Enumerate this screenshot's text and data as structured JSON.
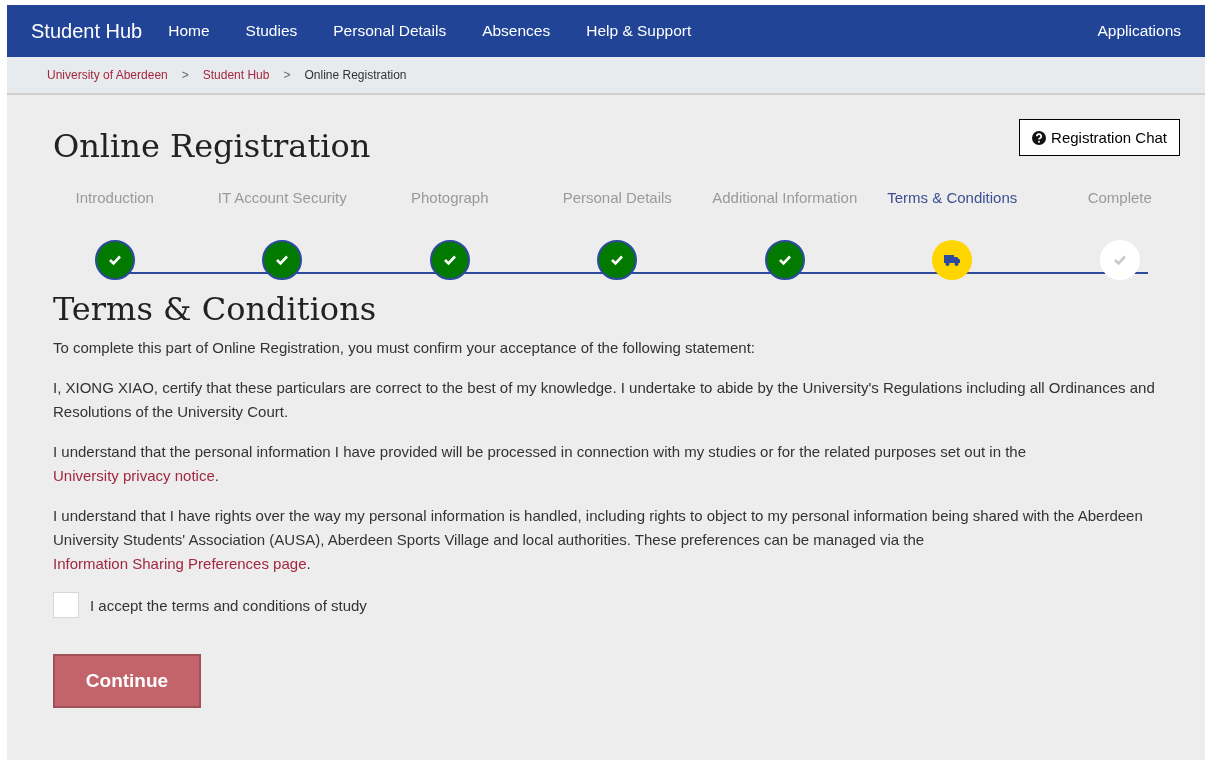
{
  "nav": {
    "brand": "Student Hub",
    "items": [
      {
        "label": "Home"
      },
      {
        "label": "Studies"
      },
      {
        "label": "Personal Details"
      },
      {
        "label": "Absences"
      },
      {
        "label": "Help & Support"
      }
    ],
    "right": "Applications"
  },
  "breadcrumb": [
    {
      "label": "University of Aberdeen",
      "kind": "link"
    },
    {
      "label": ">",
      "kind": "sep"
    },
    {
      "label": "Student Hub",
      "kind": "link"
    },
    {
      "label": ">",
      "kind": "sep"
    },
    {
      "label": "Online Registration",
      "kind": "current"
    }
  ],
  "page_title": "Online Registration",
  "chat_button": "Registration Chat",
  "steps": [
    {
      "label": "Introduction",
      "completed": true,
      "selected": false
    },
    {
      "label": "IT Account Security",
      "completed": true,
      "selected": false
    },
    {
      "label": "Photograph",
      "completed": true,
      "selected": false
    },
    {
      "label": "Personal Details",
      "completed": true,
      "selected": false
    },
    {
      "label": "Additional Information",
      "completed": true,
      "selected": false
    },
    {
      "label": "Terms & Conditions",
      "completed": false,
      "selected": true
    },
    {
      "label": "Complete",
      "completed": false,
      "selected": false
    }
  ],
  "section_title": "Terms & Conditions",
  "paragraphs": [
    {
      "parts": [
        {
          "kind": "text",
          "text": "To complete this part of Online Registration, you must confirm your acceptance of the following statement:"
        }
      ]
    },
    {
      "parts": [
        {
          "kind": "text",
          "text": "I, XIONG XIAO, certify that these particulars are correct to the best of my knowledge. I undertake to abide by the University's Regulations including all Ordinances and Resolutions of the University Court."
        }
      ]
    },
    {
      "parts": [
        {
          "kind": "text",
          "text": "I understand that the personal information I have provided will be processed in connection with my studies or for the related purposes set out in the "
        },
        {
          "kind": "link",
          "text": "University privacy notice"
        },
        {
          "kind": "text",
          "text": "."
        }
      ]
    },
    {
      "parts": [
        {
          "kind": "text",
          "text": "I understand that I have rights over the way my personal information is handled, including rights to object to my personal information being shared with the Aberdeen University Students' Association (AUSA), Aberdeen Sports Village and local authorities. These preferences can be managed via the "
        },
        {
          "kind": "link",
          "text": "Information Sharing Preferences page"
        },
        {
          "kind": "text",
          "text": "."
        }
      ]
    }
  ],
  "accept": {
    "label": "I accept the terms and conditions of study",
    "checked": false
  },
  "continue_button": {
    "label": "Continue",
    "disabled": true
  }
}
